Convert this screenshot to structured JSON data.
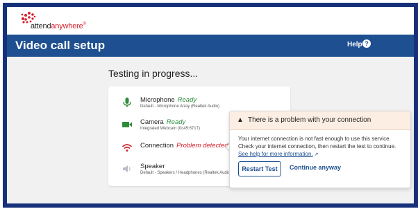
{
  "brand": {
    "part1": "attend",
    "part2": "anywhere",
    "reg": "®"
  },
  "header": {
    "title": "Video call setup",
    "help_label": "Help",
    "help_icon": "?"
  },
  "main": {
    "testing_title": "Testing in progress...",
    "devices": [
      {
        "icon": "microphone-icon",
        "label": "Microphone",
        "status": "Ready",
        "detail": "Default - Microphone Array (Realtek Audio)"
      },
      {
        "icon": "camera-icon",
        "label": "Camera",
        "status": "Ready",
        "detail": "Integrated Webcam (0c45:6717)"
      },
      {
        "icon": "wifi-icon",
        "label": "Connection",
        "status": "Problem detected",
        "detail": ""
      },
      {
        "icon": "speaker-icon",
        "label": "Speaker",
        "status": "",
        "detail": "Default - Speakers / Headphones (Realtek Audio)"
      }
    ]
  },
  "popup": {
    "warning_glyph": "▲",
    "title": "There is a problem with your connection",
    "body": "Your internet connection is not fast enough to use this service. Check your internet connection, then restart the test to continue.",
    "link": "See help for more information.",
    "link_icon": "↗",
    "restart_label": "Restart Test",
    "continue_label": "Continue anyway"
  },
  "colors": {
    "frame": "#16307a",
    "header": "#1d4f91",
    "ready": "#2e8b3a",
    "problem": "#d4202b",
    "brand_red": "#d4202b",
    "popup_head": "#fdeee4"
  }
}
